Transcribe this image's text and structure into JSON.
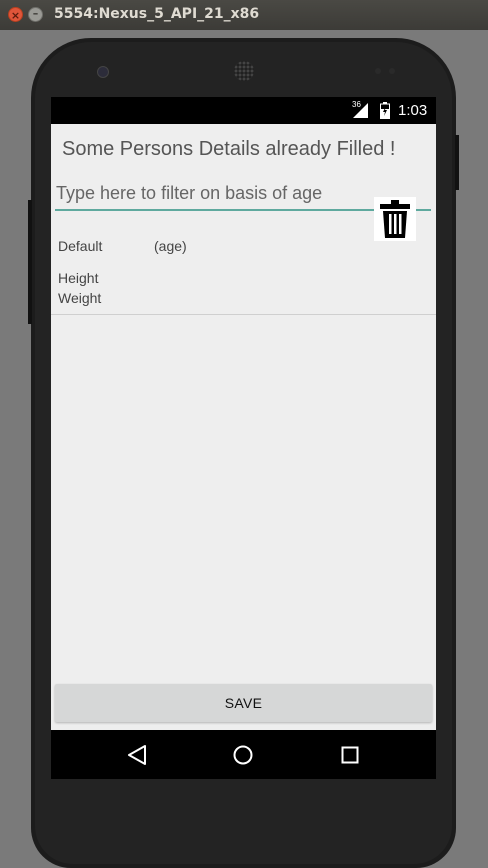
{
  "window": {
    "title": "5554:Nexus_5_API_21_x86",
    "close_symbol": "×",
    "minimize_symbol": "–"
  },
  "statusbar": {
    "network": "36",
    "time": "1:03"
  },
  "app": {
    "title": "Some Persons Details already Filled !",
    "filter_placeholder": "Type here to filter on basis of age",
    "filter_value": "",
    "items": [
      {
        "name": "Default",
        "age": "(age)",
        "height_label": "Height",
        "weight_label": "Weight"
      }
    ],
    "save_label": "SAVE"
  },
  "icons": {
    "delete": "trash-icon",
    "nav_back": "back-triangle-icon",
    "nav_home": "home-circle-icon",
    "nav_recents": "recents-square-icon"
  },
  "colors": {
    "accent": "#5ea99e",
    "screen_background": "#eeeeee",
    "save_button": "#d6d7d7"
  }
}
